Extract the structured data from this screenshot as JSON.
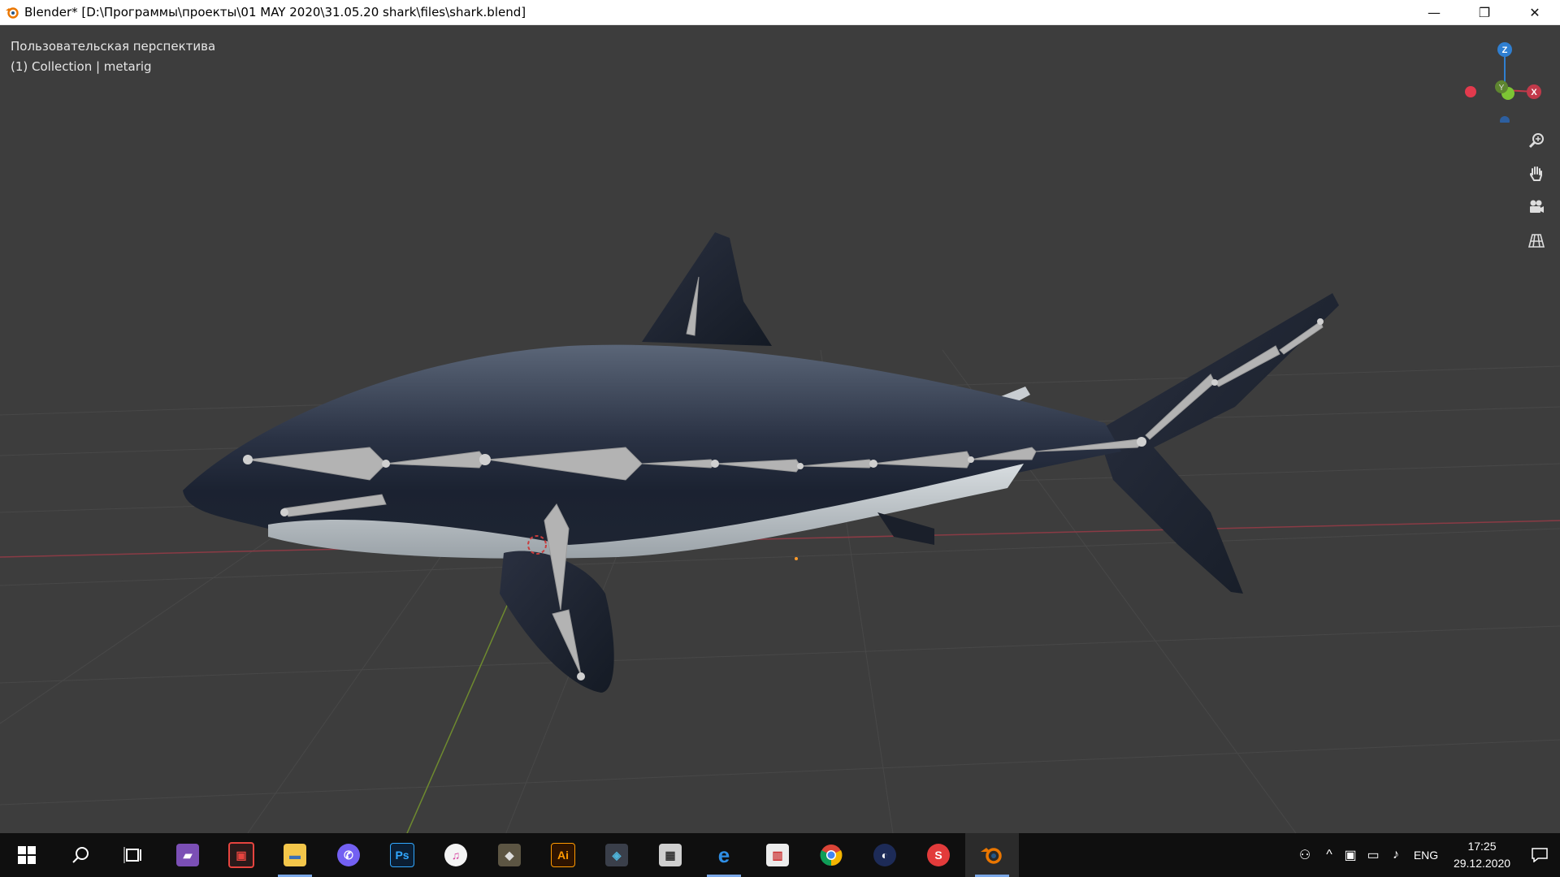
{
  "window": {
    "title": "Blender* [D:\\Программы\\проекты\\01 MAY 2020\\31.05.20 shark\\files\\shark.blend]",
    "minimize": "—",
    "restore": "❐",
    "close": "✕"
  },
  "viewport": {
    "view_name": "Пользовательская перспектива",
    "collection_info": "(1) Collection | metarig",
    "gizmo": {
      "z": "Z",
      "y": "Y",
      "x": "X"
    },
    "background_color": "#3d3d3d"
  },
  "taskbar": {
    "icons": [
      "windows-start-icon",
      "search-icon",
      "task-view-icon",
      "app-icon",
      "app-icon",
      "file-explorer-icon",
      "viber-icon",
      "photoshop-icon",
      "itunes-icon",
      "gimp-icon",
      "illustrator-icon",
      "layers-app-icon",
      "app-icon",
      "edge-icon",
      "app-icon",
      "chrome-icon",
      "cinema4d-icon",
      "app-icon",
      "blender-icon"
    ],
    "photoshop_label": "Ps",
    "illustrator_label": "Ai",
    "lang": "ENG",
    "time": "17:25",
    "date": "29.12.2020"
  }
}
